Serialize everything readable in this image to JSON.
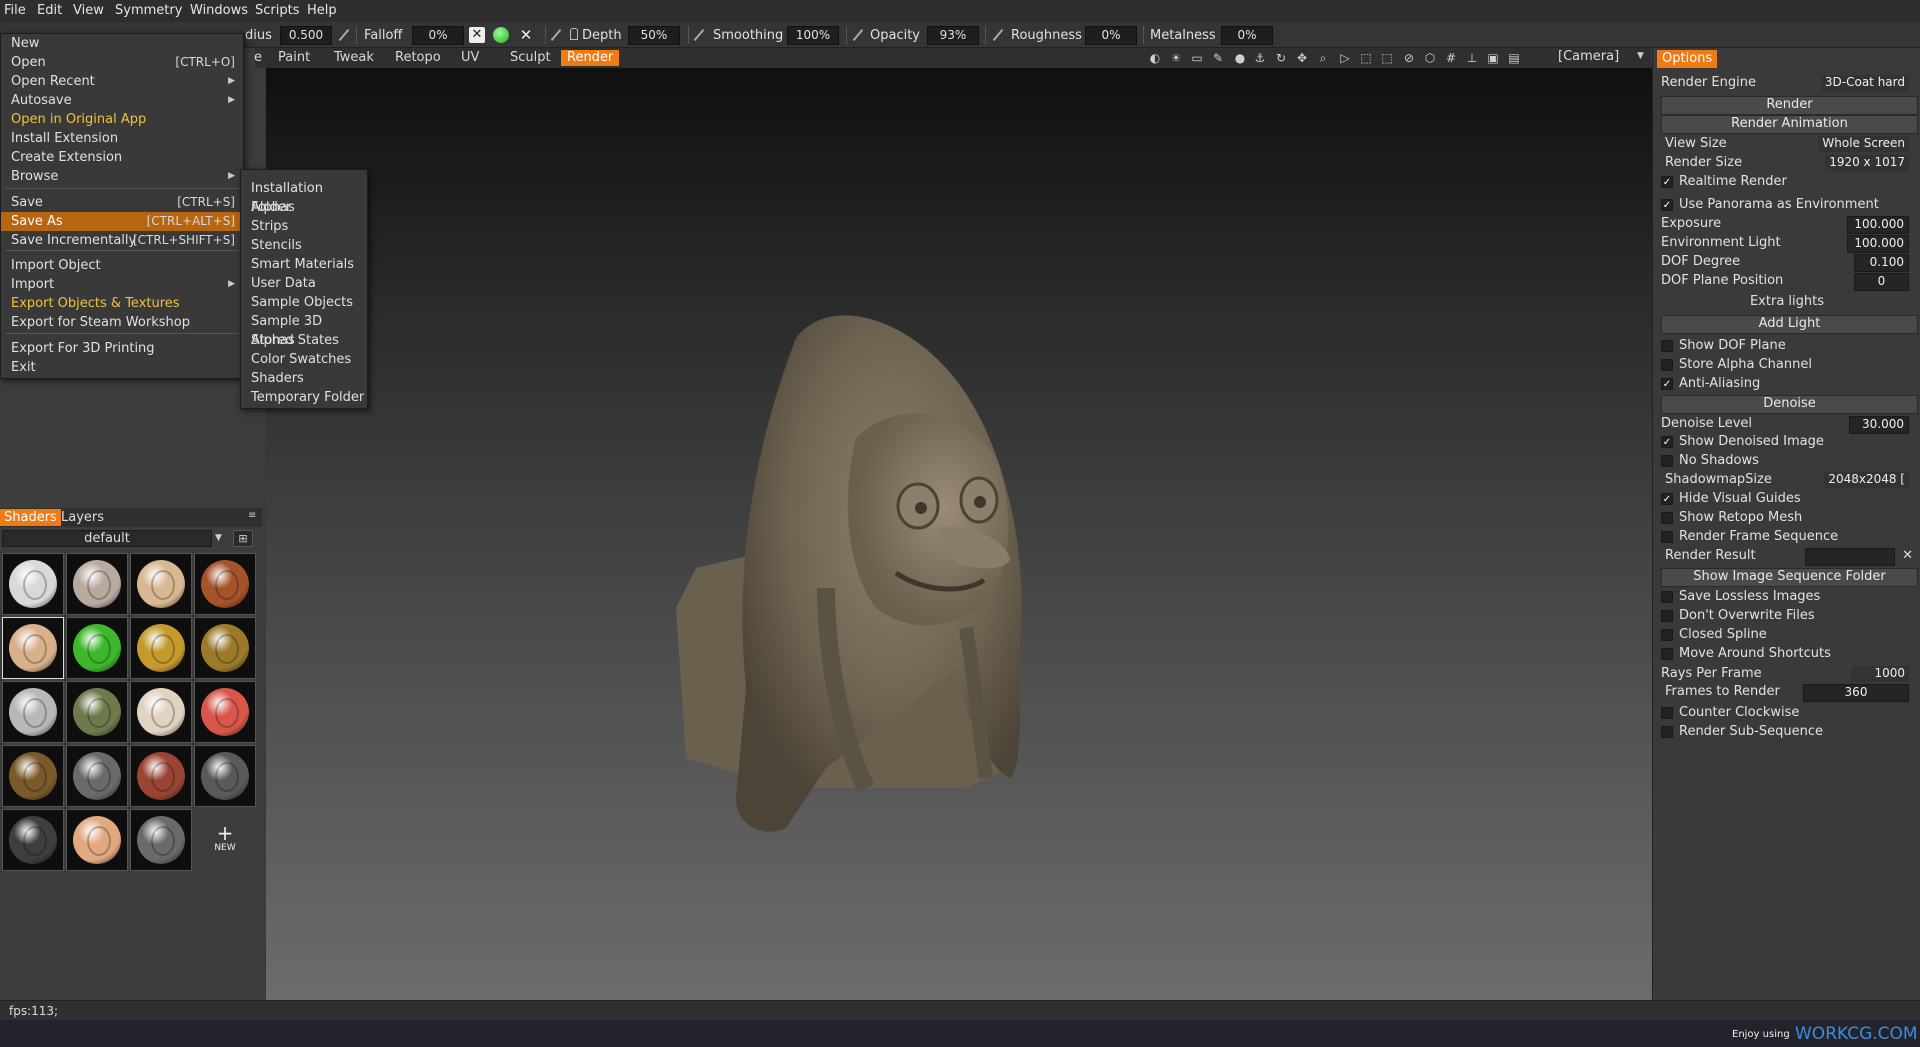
{
  "menubar": {
    "items": [
      "File",
      "Edit",
      "View",
      "Symmetry",
      "Windows",
      "Scripts",
      "Help"
    ]
  },
  "toolbar": {
    "radius_label": "dius",
    "radius_value": "0.500",
    "falloff_label": "Falloff",
    "falloff_value": "0%",
    "depth_label": "Depth",
    "depth_value": "50%",
    "smoothing_label": "Smoothing",
    "smoothing_value": "100%",
    "opacity_label": "Opacity",
    "opacity_value": "93%",
    "roughness_label": "Roughness",
    "roughness_value": "0%",
    "metalness_label": "Metalness",
    "metalness_value": "0%"
  },
  "rooms": {
    "partial": "e",
    "items": [
      "Paint",
      "Tweak",
      "Retopo",
      "UV",
      "Sculpt",
      "Render"
    ],
    "active": "Render",
    "camera": "[Camera]"
  },
  "file_menu": {
    "items": [
      {
        "label": "New",
        "shortcut": ""
      },
      {
        "label": "Open",
        "shortcut": "[CTRL+O]"
      },
      {
        "label": "Open Recent",
        "shortcut": ""
      },
      {
        "label": "Autosave",
        "shortcut": ""
      },
      {
        "label": "Open in Original App",
        "shortcut": ""
      },
      {
        "label": "Install Extension",
        "shortcut": ""
      },
      {
        "label": "Create Extension",
        "shortcut": ""
      },
      {
        "label": "Browse",
        "shortcut": ""
      },
      {
        "label": "Save",
        "shortcut": "[CTRL+S]"
      },
      {
        "label": "Save As",
        "shortcut": "[CTRL+ALT+S]"
      },
      {
        "label": "Save Incrementally",
        "shortcut": "[CTRL+SHIFT+S]"
      },
      {
        "label": "Import Object",
        "shortcut": ""
      },
      {
        "label": "Import",
        "shortcut": ""
      },
      {
        "label": "Export Objects & Textures",
        "shortcut": ""
      },
      {
        "label": "Export for Steam Workshop",
        "shortcut": ""
      },
      {
        "label": "Export For 3D Printing",
        "shortcut": ""
      },
      {
        "label": "Exit",
        "shortcut": ""
      }
    ]
  },
  "browse_menu": {
    "items": [
      "Installation Folder",
      "Alphas",
      "Strips",
      "Stencils",
      "Smart Materials",
      "User Data",
      "Sample Objects",
      "Sample 3D Alphas",
      "Stored States",
      "Color Swatches",
      "Shaders",
      "Temporary Folder"
    ]
  },
  "shaders": {
    "tabs": [
      "Shaders",
      "Layers"
    ],
    "preset": "default",
    "new_label": "NEW",
    "colors": [
      "#d9d9d9",
      "#b9aaa0",
      "#d8b892",
      "#a4532a",
      "#d8b08a",
      "#3cb82a",
      "#c49a2c",
      "#9c7a2a",
      "#b8b8b8",
      "#6e7a4c",
      "#e2d2c2",
      "#d8564a",
      "#7a5a2a",
      "#6a6a6a",
      "#9a4434",
      "#5a5a5a",
      "#3e3e3e",
      "#e2a880",
      "#6a6a6a"
    ]
  },
  "options": {
    "tab": "Options",
    "render_engine_label": "Render Engine",
    "render_engine_value": "3D-Coat hard",
    "render_btn": "Render",
    "render_anim_btn": "Render Animation",
    "view_size_label": "View Size",
    "view_size_value": "Whole Screen",
    "render_size_label": "Render Size",
    "render_size_value": "1920 x 1017",
    "realtime_render": "Realtime Render",
    "use_panorama": "Use Panorama as Environment",
    "exposure_label": "Exposure",
    "exposure_value": "100.000",
    "env_light_label": "Environment Light",
    "env_light_value": "100.000",
    "dof_degree_label": "DOF Degree",
    "dof_degree_value": "0.100",
    "dof_plane_label": "DOF Plane Position",
    "dof_plane_value": "0",
    "extra_lights": "Extra lights",
    "add_light": "Add Light",
    "show_dof_plane": "Show DOF Plane",
    "store_alpha": "Store Alpha Channel",
    "anti_aliasing": "Anti-Aliasing",
    "denoise_btn": "Denoise",
    "denoise_level_label": "Denoise Level",
    "denoise_level_value": "30.000",
    "show_denoised": "Show Denoised Image",
    "no_shadows": "No Shadows",
    "shadowmap_label": "ShadowmapSize",
    "shadowmap_value": "2048x2048 [",
    "hide_guides": "Hide Visual Guides",
    "show_retopo": "Show Retopo Mesh",
    "render_frame_seq": "Render Frame Sequence",
    "render_result": "Render Result",
    "show_seq_folder": "Show Image Sequence Folder",
    "save_lossless": "Save Lossless Images",
    "dont_overwrite": "Don't Overwrite Files",
    "closed_spline": "Closed Spline",
    "move_shortcuts": "Move Around Shortcuts",
    "rays_label": "Rays Per Frame",
    "rays_value": "1000",
    "frames_label": "Frames to Render",
    "frames_value": "360",
    "counter_clockwise": "Counter Clockwise",
    "render_subseq": "Render Sub-Sequence"
  },
  "status": {
    "fps": "fps:113;"
  },
  "bottom": {
    "enjoy": "Enjoy using",
    "brand": "WORKCG.COM"
  }
}
